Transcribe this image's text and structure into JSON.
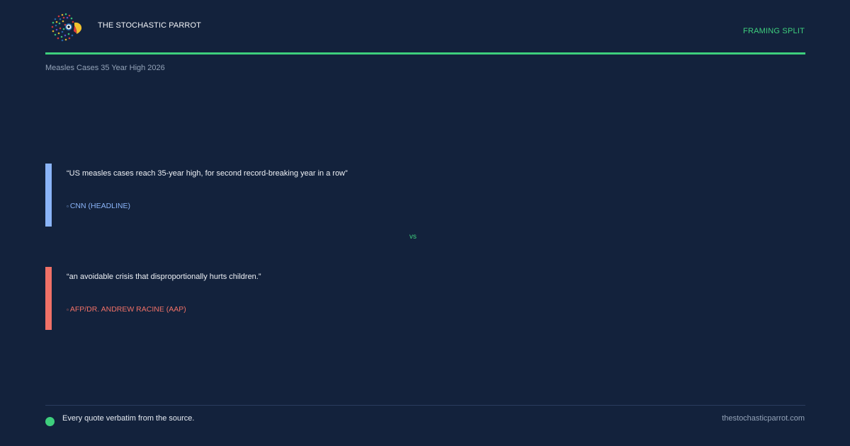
{
  "header": {
    "brand": "THE STOCHASTIC PARROT",
    "tag": "FRAMING SPLIT",
    "logo_icon": "parrot-logo-icon"
  },
  "topic": "Measles Cases 35 Year High 2026",
  "quotes": [
    {
      "text": "“US measles cases reach 35-year high, for second record-breaking year in a row”",
      "source": "CNN (HEADLINE)",
      "source_icon": "link-icon",
      "color": "#8ab4f8"
    },
    {
      "text": "“an avoidable crisis that disproportionally hurts children.”",
      "source": "AFP/DR. ANDREW RACINE (AAP)",
      "source_icon": "link-icon",
      "color": "#f07167"
    }
  ],
  "vs_label": "vs",
  "footer": {
    "note": "Every quote verbatim from the source.",
    "site": "thestochasticparrot.com",
    "dot_color": "#3ecf7d"
  },
  "colors": {
    "background": "#13223c",
    "accent": "#3ecf7d"
  }
}
